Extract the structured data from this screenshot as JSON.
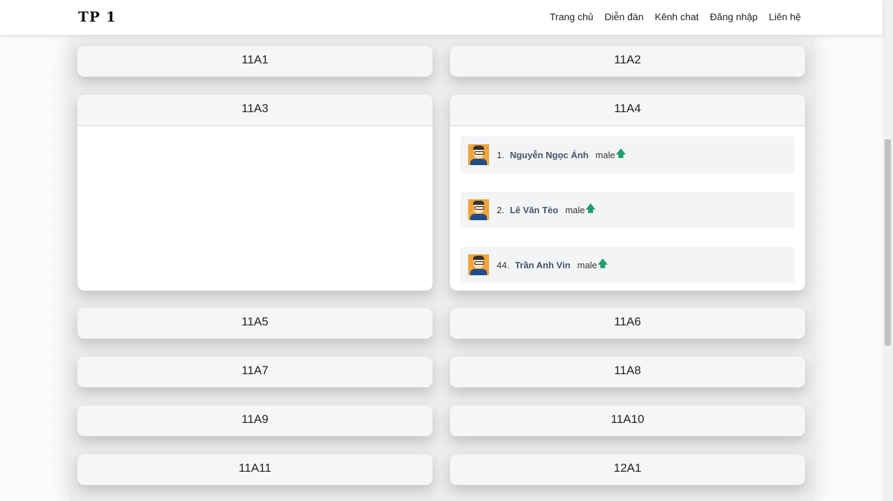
{
  "brand": "TP 1",
  "nav": [
    "Trang chủ",
    "Diễn đàn",
    "Kênh chat",
    "Đăng nhập",
    "Liên hệ"
  ],
  "classes": [
    "11A1",
    "11A2",
    "11A3",
    "11A4",
    "11A5",
    "11A6",
    "11A7",
    "11A8",
    "11A9",
    "11A10",
    "11A11",
    "12A1"
  ],
  "students_11A4": [
    {
      "num": "1.",
      "name": "Nguyễn Ngọc Ánh",
      "gender": "male",
      "arrow": "🡅"
    },
    {
      "num": "2.",
      "name": "Lê Văn Tèo",
      "gender": "male",
      "arrow": "🡅"
    },
    {
      "num": "44.",
      "name": "Trần Anh Vin",
      "gender": "male",
      "arrow": "🡅"
    }
  ],
  "colors": {
    "accent_arrow": "#1e9e6a",
    "name_text": "#44546a",
    "avatar_bg": "#f1a43c"
  }
}
